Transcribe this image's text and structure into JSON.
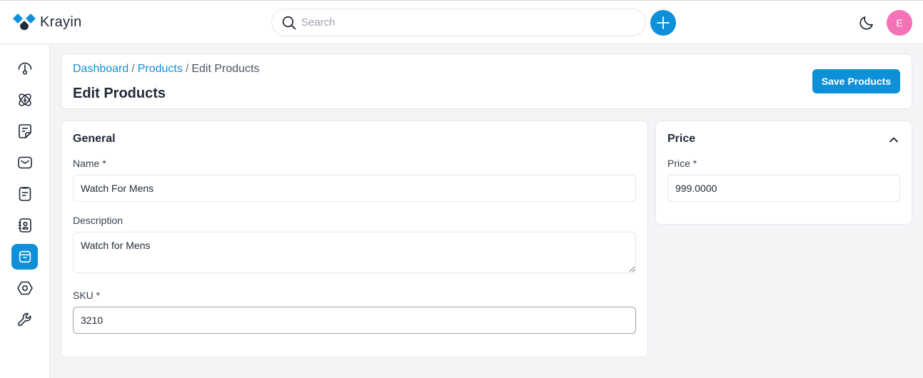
{
  "app": {
    "brand_name": "Krayin",
    "brand_colors": {
      "primary": "#0e90d9",
      "dark": "#1f2937"
    }
  },
  "topbar": {
    "search_placeholder": "Search",
    "search_value": "",
    "add_icon": "plus-icon",
    "theme_icon": "moon-icon",
    "user_initial": "E",
    "avatar_color": "#f472b6"
  },
  "sidebar": {
    "items": [
      {
        "name": "dashboard",
        "icon": "gauge-icon",
        "active": false
      },
      {
        "name": "leads",
        "icon": "atom-bolt-icon",
        "active": false
      },
      {
        "name": "quotes",
        "icon": "sticky-note-icon",
        "active": false
      },
      {
        "name": "mail",
        "icon": "mail-icon",
        "active": false
      },
      {
        "name": "activities",
        "icon": "clipboard-icon",
        "active": false
      },
      {
        "name": "contacts",
        "icon": "contact-book-icon",
        "active": false
      },
      {
        "name": "products",
        "icon": "archive-box-icon",
        "active": true
      },
      {
        "name": "settings",
        "icon": "hexagon-gear-icon",
        "active": false
      },
      {
        "name": "configuration",
        "icon": "wrench-icon",
        "active": false
      }
    ]
  },
  "header": {
    "breadcrumb": [
      {
        "label": "Dashboard",
        "link": true
      },
      {
        "label": "Products",
        "link": true
      },
      {
        "label": "Edit Products",
        "link": false
      }
    ],
    "separator": "/",
    "title": "Edit Products",
    "save_label": "Save Products"
  },
  "general": {
    "title": "General",
    "name_label": "Name *",
    "name_value": "Watch For Mens",
    "description_label": "Description",
    "description_value": "Watch for Mens",
    "sku_label": "SKU *",
    "sku_value": "3210"
  },
  "price": {
    "title": "Price",
    "price_label": "Price *",
    "price_value": "999.0000",
    "collapse_icon": "chevron-up-icon"
  }
}
